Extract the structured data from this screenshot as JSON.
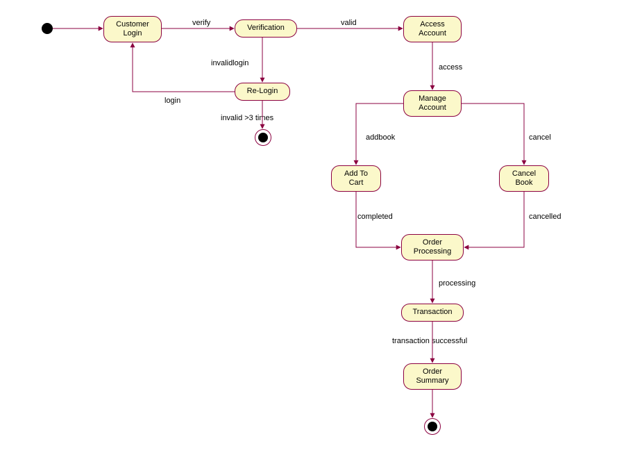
{
  "chart_data": {
    "type": "state-diagram",
    "title": "",
    "states": [
      {
        "id": "initial",
        "kind": "initial"
      },
      {
        "id": "customer_login",
        "label": "Customer\nLogin"
      },
      {
        "id": "verification",
        "label": "Verification"
      },
      {
        "id": "access_account",
        "label": "Access\nAccount"
      },
      {
        "id": "re_login",
        "label": "Re-Login"
      },
      {
        "id": "final_login",
        "kind": "final"
      },
      {
        "id": "manage_account",
        "label": "Manage\nAccount"
      },
      {
        "id": "add_to_cart",
        "label": "Add To\nCart"
      },
      {
        "id": "cancel_book",
        "label": "Cancel\nBook"
      },
      {
        "id": "order_processing",
        "label": "Order\nProcessing"
      },
      {
        "id": "transaction",
        "label": "Transaction"
      },
      {
        "id": "order_summary",
        "label": "Order\nSummary"
      },
      {
        "id": "final_order",
        "kind": "final"
      }
    ],
    "transitions": [
      {
        "from": "initial",
        "to": "customer_login",
        "label": ""
      },
      {
        "from": "customer_login",
        "to": "verification",
        "label": "verify"
      },
      {
        "from": "verification",
        "to": "access_account",
        "label": "valid"
      },
      {
        "from": "verification",
        "to": "re_login",
        "label": "invalidlogin"
      },
      {
        "from": "re_login",
        "to": "customer_login",
        "label": "login"
      },
      {
        "from": "re_login",
        "to": "final_login",
        "label": "invalid >3 times"
      },
      {
        "from": "access_account",
        "to": "manage_account",
        "label": "access"
      },
      {
        "from": "manage_account",
        "to": "add_to_cart",
        "label": "addbook"
      },
      {
        "from": "manage_account",
        "to": "cancel_book",
        "label": "cancel"
      },
      {
        "from": "add_to_cart",
        "to": "order_processing",
        "label": "completed"
      },
      {
        "from": "cancel_book",
        "to": "order_processing",
        "label": "cancelled"
      },
      {
        "from": "order_processing",
        "to": "transaction",
        "label": "processing"
      },
      {
        "from": "transaction",
        "to": "order_summary",
        "label": "transaction successful"
      },
      {
        "from": "order_summary",
        "to": "final_order",
        "label": ""
      }
    ]
  },
  "nodes": {
    "customer_login": "Customer\nLogin",
    "verification": "Verification",
    "access_account": "Access\nAccount",
    "re_login": "Re-Login",
    "manage_account": "Manage\nAccount",
    "add_to_cart": "Add To\nCart",
    "cancel_book": "Cancel\nBook",
    "order_processing": "Order\nProcessing",
    "transaction": "Transaction",
    "order_summary": "Order\nSummary"
  },
  "labels": {
    "verify": "verify",
    "valid": "valid",
    "invalidlogin": "invalidlogin",
    "login": "login",
    "invalid3": "invalid >3 times",
    "access": "access",
    "addbook": "addbook",
    "cancel": "cancel",
    "completed": "completed",
    "cancelled": "cancelled",
    "processing": "processing",
    "transaction_successful": "transaction successful"
  }
}
